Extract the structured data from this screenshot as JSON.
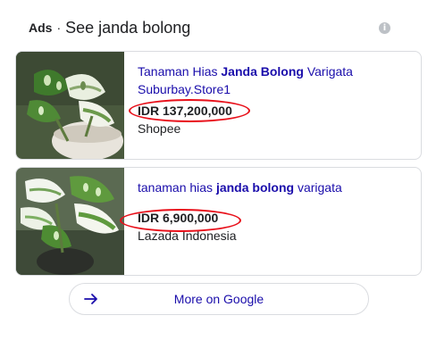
{
  "header": {
    "ads_label": "Ads",
    "separator": "·",
    "title": "See janda bolong",
    "info_icon": "info-icon"
  },
  "products": [
    {
      "title_pre": "Tanaman Hias ",
      "title_bold": "Janda Bolong",
      "title_post": " Varigata Suburbay.Store1",
      "price": "IDR 137,200,000",
      "merchant": "Shopee"
    },
    {
      "title_pre": "tanaman hias ",
      "title_bold": "janda bolong",
      "title_post": " varigata",
      "price": "IDR 6,900,000",
      "merchant": "Lazada Indonesia"
    }
  ],
  "more_button": {
    "label": "More on Google",
    "icon": "arrow-right-icon"
  },
  "colors": {
    "link": "#1a0dab",
    "highlight_circle": "#e8101a",
    "border": "#dadce0"
  }
}
